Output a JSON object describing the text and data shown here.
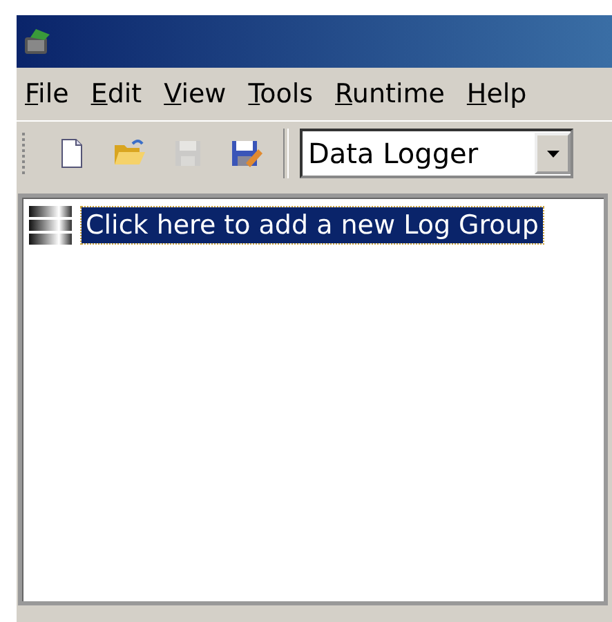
{
  "menu": [
    {
      "label": "File"
    },
    {
      "label": "Edit"
    },
    {
      "label": "View"
    },
    {
      "label": "Tools"
    },
    {
      "label": "Runtime"
    },
    {
      "label": "Help"
    }
  ],
  "toolbar": {
    "buttons": [
      {
        "kind": "new",
        "disabled": false
      },
      {
        "kind": "open",
        "disabled": false
      },
      {
        "kind": "save",
        "disabled": true
      },
      {
        "kind": "save-as",
        "disabled": false
      }
    ],
    "dropdown": {
      "value": "Data Logger"
    }
  },
  "tree": {
    "items": [
      {
        "label": "Click here to add a new Log Group",
        "selected": true
      }
    ]
  }
}
